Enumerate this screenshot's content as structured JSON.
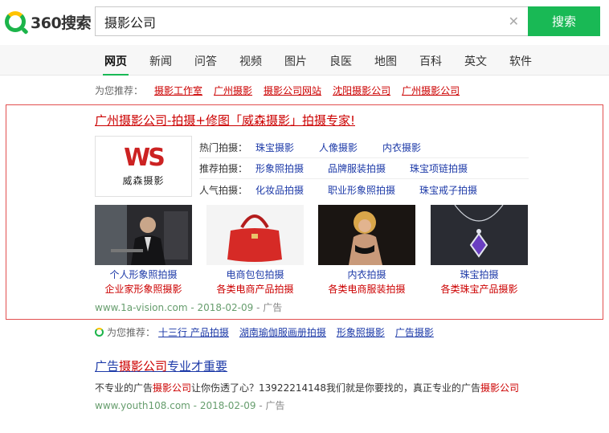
{
  "header": {
    "logo_text": "360搜索",
    "query": "摄影公司",
    "search_button": "搜索",
    "clear_glyph": "✕"
  },
  "tabs": [
    "网页",
    "新闻",
    "问答",
    "视频",
    "图片",
    "良医",
    "地图",
    "百科",
    "英文",
    "软件"
  ],
  "recommend_top": {
    "label": "为您推荐：",
    "items": [
      "摄影工作室",
      "广州摄影",
      "摄影公司网站",
      "沈阳摄影公司",
      "广州摄影公司"
    ]
  },
  "ad": {
    "title": "广州摄影公司-拍摄+修图「威森摄影」拍摄专家!",
    "logo_mark": "WS",
    "logo_brand": "威森摄影",
    "lines": [
      {
        "label": "热门拍摄：",
        "links": [
          "珠宝摄影",
          "人像摄影",
          "内衣摄影"
        ]
      },
      {
        "label": "推荐拍摄：",
        "links": [
          "形象照拍摄",
          "品牌服装拍摄",
          "珠宝项链拍摄"
        ]
      },
      {
        "label": "人气拍摄：",
        "links": [
          "化妆品拍摄",
          "职业形象照拍摄",
          "珠宝戒子拍摄"
        ]
      }
    ],
    "thumbs": [
      {
        "cap1": "个人形象照拍摄",
        "cap2": "企业家形象照摄影"
      },
      {
        "cap1": "电商包包拍摄",
        "cap2": "各类电商产品拍摄"
      },
      {
        "cap1": "内衣拍摄",
        "cap2": "各类电商服装拍摄"
      },
      {
        "cap1": "珠宝拍摄",
        "cap2": "各类珠宝产品摄影"
      }
    ],
    "url": "www.1a-vision.com - 2018-02-09",
    "tag": " - 广告"
  },
  "recommend_bottom": {
    "label": "为您推荐：",
    "items": [
      "十三行 产品拍摄",
      "湖南瑜伽服画册拍摄",
      "形象照摄影",
      "广告摄影"
    ]
  },
  "result2": {
    "title_pre": "广告",
    "title_em": "摄影公司",
    "title_post": "专业才重要",
    "desc_pre": "不专业的广告",
    "desc_em1": "摄影公司",
    "desc_mid": "让你伤透了心？13922214148我们就是你要找的，真正专业的广告",
    "desc_em2": "摄影公司",
    "url": "www.youth108.com - 2018-02-09",
    "tag": " - 广告"
  },
  "colors": {
    "accent": "#19b955",
    "link": "#1d3aa8",
    "highlight": "#cc0000",
    "ad_border": "#e24f4f"
  }
}
